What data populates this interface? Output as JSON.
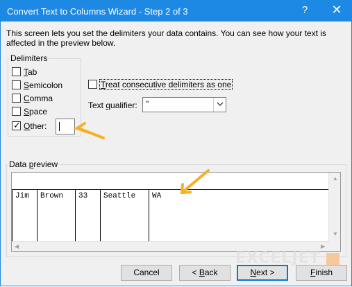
{
  "window": {
    "title": "Convert Text to Columns Wizard - Step 2 of 3",
    "help_glyph": "?",
    "close_glyph": "✕"
  },
  "description": "This screen lets you set the delimiters your data contains.  You can see how your text is affected in the preview below.",
  "delimiters": {
    "group_label": "Delimiters",
    "items": [
      {
        "key": "T",
        "rest": "ab",
        "checked": false
      },
      {
        "key": "S",
        "rest": "emicolon",
        "checked": false
      },
      {
        "key": "C",
        "rest": "omma",
        "checked": false
      },
      {
        "key": "S",
        "rest": "pace",
        "checked": false
      },
      {
        "key": "O",
        "rest": "ther:",
        "checked": true
      }
    ],
    "other_value": ""
  },
  "consecutive": {
    "pre": "",
    "key": "T",
    "rest": "reat consecutive delimiters as one",
    "checked": false
  },
  "text_qualifier": {
    "pre": "Text ",
    "key": "q",
    "rest": "ualifier:",
    "value": "\""
  },
  "preview": {
    "label_pre": "Data ",
    "label_key": "p",
    "label_rest": "review",
    "columns": [
      "Jim",
      "Brown",
      "33",
      "Seattle",
      "WA"
    ]
  },
  "buttons": {
    "cancel": "Cancel",
    "back": "< Back",
    "back_key": "B",
    "next": "Next >",
    "next_key": "N",
    "finish": "Finish",
    "finish_key": "F"
  },
  "watermark": "EXCELJET",
  "colors": {
    "titlebar": "#1e88e5",
    "arrow": "#f5b026",
    "default_button_border": "#0078d7"
  },
  "icons": {
    "checkmark": "✓",
    "dropdown": "chevron-down-icon"
  }
}
